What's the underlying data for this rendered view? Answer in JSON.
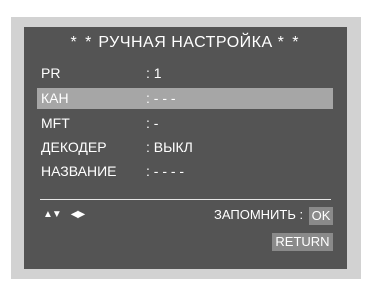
{
  "menu": {
    "title_prefix": "* *",
    "title": "РУЧНАЯ НАСТРОЙКА",
    "title_suffix": "* *",
    "rows": [
      {
        "label": "PR",
        "value": ":  1",
        "selected": false
      },
      {
        "label": "КАН",
        "value": ": - - -",
        "selected": true
      },
      {
        "label": "MFT",
        "value": ":  -",
        "selected": false
      },
      {
        "label": "ДЕКОДЕР",
        "value": ": ВЫКЛ",
        "selected": false
      },
      {
        "label": "НАЗВАНИЕ",
        "value": ": - - - -",
        "selected": false
      }
    ]
  },
  "footer": {
    "nav_up_down": "▲▼",
    "nav_left_right": "◀▶",
    "store_label": "ЗАПОМНИТЬ :",
    "ok_label": "OK",
    "return_label": "RETURN"
  },
  "colors": {
    "frame": "#d2d2d2",
    "screen": "#545454",
    "highlight": "#a6a6a6",
    "button": "#8a8a8a",
    "text": "#ffffff"
  }
}
